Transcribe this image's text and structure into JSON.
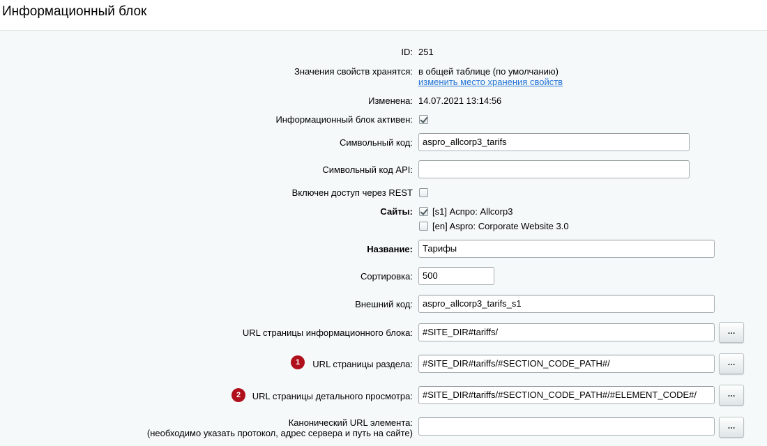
{
  "header": {
    "title": "Информационный блок"
  },
  "form": {
    "id": {
      "label": "ID:",
      "value": "251"
    },
    "storage": {
      "label": "Значения свойств хранятся:",
      "value": "в общей таблице (по умолчанию)",
      "link": "изменить место хранения свойств"
    },
    "modified": {
      "label": "Изменена:",
      "value": "14.07.2021 13:14:56"
    },
    "active": {
      "label": "Информационный блок активен:",
      "checked": true
    },
    "code": {
      "label": "Символьный код:",
      "value": "aspro_allcorp3_tarifs"
    },
    "api_code": {
      "label": "Символьный код API:",
      "value": ""
    },
    "rest": {
      "label": "Включен доступ через REST",
      "checked": false
    },
    "sites": {
      "label": "Сайты:",
      "options": [
        {
          "label": "[s1] Аспро: Allcorp3",
          "checked": true
        },
        {
          "label": "[en] Aspro: Corporate Website 3.0",
          "checked": false
        }
      ]
    },
    "name": {
      "label": "Название:",
      "value": "Тарифы"
    },
    "sort": {
      "label": "Сортировка:",
      "value": "500"
    },
    "external_code": {
      "label": "Внешний код:",
      "value": "aspro_allcorp3_tarifs_s1"
    },
    "list_url": {
      "label": "URL страницы информационного блока:",
      "value": "#SITE_DIR#tariffs/"
    },
    "section_url": {
      "label": "URL страницы раздела:",
      "value": "#SITE_DIR#tariffs/#SECTION_CODE_PATH#/",
      "badge": "1"
    },
    "detail_url": {
      "label": "URL страницы детального просмотра:",
      "value": "#SITE_DIR#tariffs/#SECTION_CODE_PATH#/#ELEMENT_CODE#/",
      "badge": "2"
    },
    "canonical_url": {
      "label_line1": "Канонический URL элемента:",
      "label_line2": "(необходимо указать протокол, адрес сервера и путь на сайте)",
      "value": ""
    },
    "picker_button_label": "..."
  },
  "colors": {
    "link": "#2675d7",
    "badge": "#b0101b",
    "background": "#f5f9f9"
  }
}
